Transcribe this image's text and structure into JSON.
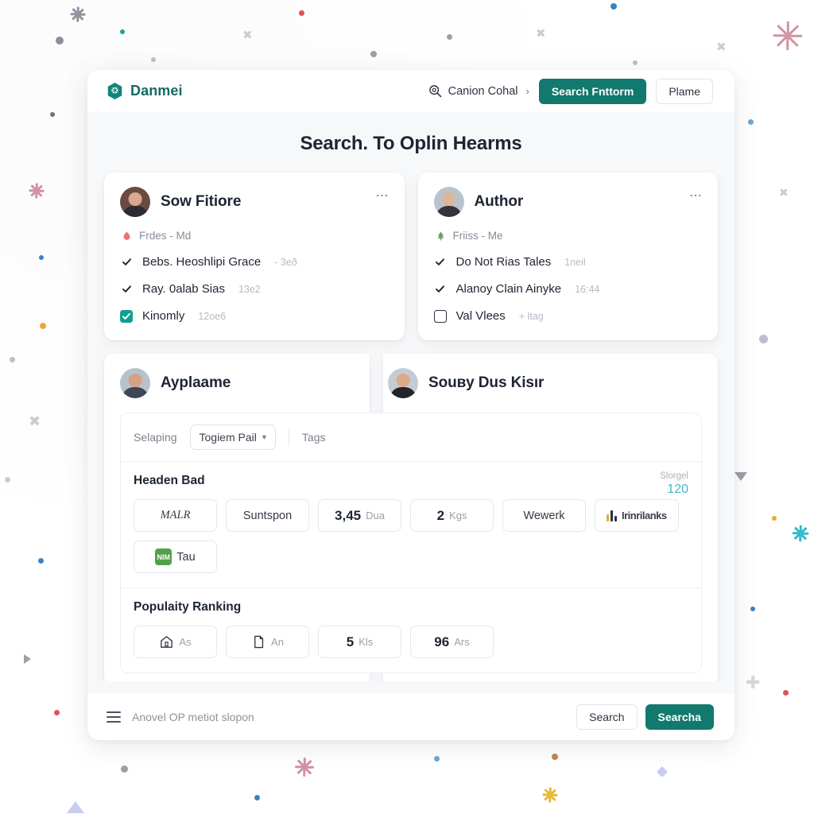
{
  "header": {
    "brand": "Danmei",
    "logo_icon": "cube-hexagon-icon",
    "nav_link": "Canion Cohal",
    "nav_link_icon": "magnifier-icon",
    "nav_chevron": "›",
    "primary_button": "Search Fnttorm",
    "secondary_button": "Plame"
  },
  "page": {
    "title": "Search. To Oplin Hearms"
  },
  "cards": [
    {
      "name": "Sow Fitiore",
      "avatar": "avatar-woman",
      "menu_icon": "kebab-menu-icon",
      "sub_icon": "droplet-icon",
      "sub_icon_color": "#e8756f",
      "sub_text": "Frdes  -  Md",
      "items": [
        {
          "label": "Bebs. Heoshlipi Grace",
          "meta": "- 3eð",
          "checked": true,
          "style": "plain"
        },
        {
          "label": "Ray. 0alab Sias",
          "meta": "13e2",
          "checked": true,
          "style": "plain"
        },
        {
          "label": "Kinomly",
          "meta": "12oe6",
          "checked": true,
          "style": "filled"
        }
      ]
    },
    {
      "name": "Author",
      "avatar": "avatar-man-gray",
      "menu_icon": "kebab-menu-icon",
      "sub_icon": "tree-icon",
      "sub_icon_color": "#68a45c",
      "sub_text": "Friiss  -  Me",
      "items": [
        {
          "label": "Do Not Rias Tales",
          "meta": "1neil",
          "checked": true,
          "style": "plain"
        },
        {
          "label": "Alanoy Clain Ainyke",
          "meta": "16:44",
          "checked": true,
          "style": "plain"
        },
        {
          "label": "Val Vlees",
          "meta": "+ ltag",
          "checked": false,
          "style": "empty"
        }
      ]
    }
  ],
  "lower": {
    "left_name": "Ayplaame",
    "left_avatar": "avatar-man-suit",
    "right_name": "Souвy Dus Kisır",
    "right_avatar": "avatar-man-dark-suit",
    "tabs": {
      "left_label": "Selaping",
      "select_value": "Togiem Pail",
      "select_chevron": "▾",
      "right_label": "Tags"
    },
    "sections": [
      {
        "title": "Headen Bad",
        "meter_label": "Slorgel",
        "meter_value": "120",
        "chips": [
          {
            "text": "MALR",
            "kind": "text-script"
          },
          {
            "text": "Suntspon",
            "kind": "text"
          },
          {
            "big": "3,45",
            "unit": "Dua",
            "kind": "value"
          },
          {
            "big": "2",
            "unit": "Kgs",
            "kind": "value"
          },
          {
            "text": "Wewerk",
            "kind": "text"
          },
          {
            "text": "Irinrilanks",
            "kind": "bars",
            "icon": "bar-chart-icon"
          },
          {
            "text": "Tau",
            "kind": "badge",
            "badge": "NIM",
            "badge_color": "#53a048"
          }
        ]
      },
      {
        "title": "Populaity Ranking",
        "meter_label": "",
        "meter_value": "",
        "chips": [
          {
            "text": "As",
            "kind": "icon",
            "icon": "home-icon"
          },
          {
            "text": "An",
            "kind": "icon",
            "icon": "document-icon"
          },
          {
            "big": "5",
            "unit": "Kls",
            "kind": "value"
          },
          {
            "big": "96",
            "unit": "Ars",
            "kind": "value"
          }
        ]
      }
    ]
  },
  "footer": {
    "menu_icon": "hamburger-icon",
    "text": "Anovel OP metiot slopon",
    "secondary_button": "Search",
    "primary_button": "Searcha"
  },
  "colors": {
    "brand_teal": "#156a64",
    "primary_teal": "#11796e",
    "check_teal": "#11a08f",
    "meter_cyan": "#49b6c4",
    "badge_green": "#53a048",
    "accent_pink": "#d192a3",
    "page_bg": "#f7f8f9"
  }
}
